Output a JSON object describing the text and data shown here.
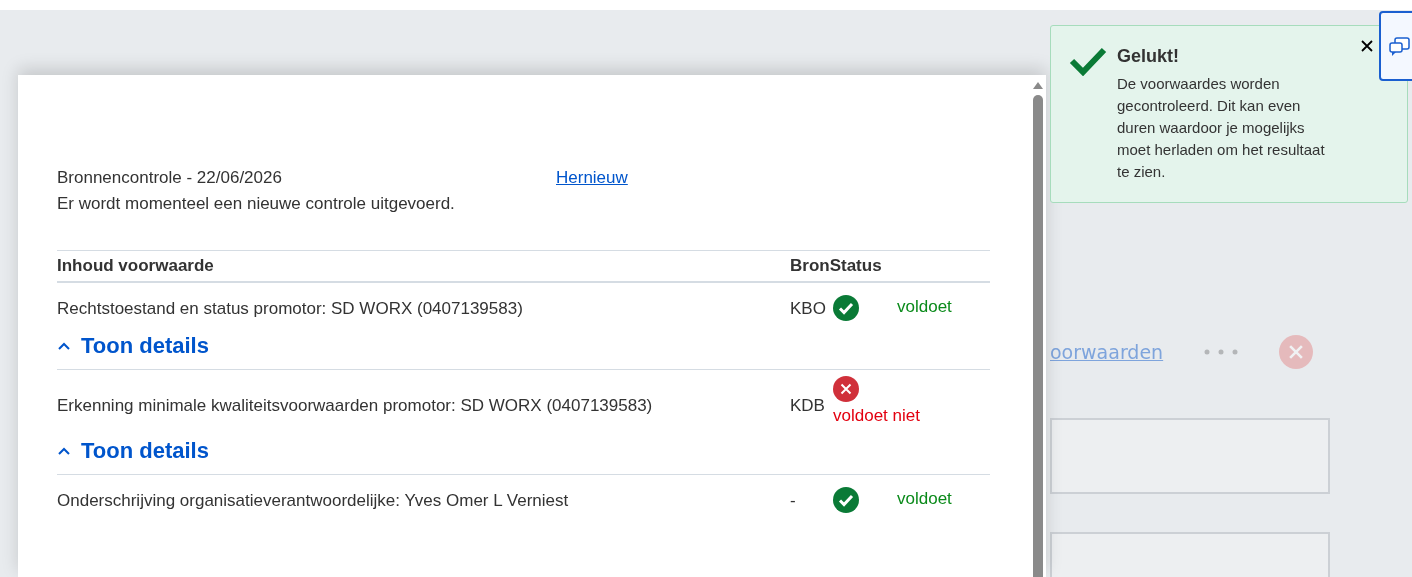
{
  "background": {
    "link": "oorwaarden"
  },
  "modal": {
    "check_title": "Bronnencontrole - 22/06/2026",
    "renew_link": "Hernieuw",
    "message": "Er wordt momenteel een nieuwe controle uitgevoerd.",
    "columns": [
      "Inhoud voorwaarde",
      "BronStatus"
    ],
    "rows": [
      {
        "content": "Rechtstoestand en status promotor: SD WORX (0407139583)",
        "source": "KBO",
        "kind": "ok",
        "status": "voldoet",
        "details": {
          "label": "Toon details",
          "expanded": true
        }
      },
      {
        "content": "Erkenning minimale kwaliteitsvoorwaarden promotor: SD WORX (0407139583)",
        "source": "KDB",
        "kind": "fail",
        "status": "voldoet niet",
        "details": {
          "label": "Toon details",
          "expanded": true
        }
      },
      {
        "content": "Onderschrijving organisatieverantwoordelijke: Yves Omer L Verniest",
        "source": "-",
        "kind": "ok",
        "status": "voldoet"
      }
    ]
  },
  "toast": {
    "title": "Gelukt!",
    "message": "De voorwaardes worden gecontroleerd. Dit kan even duren waardoor je mogelijks moet herladen om het resultaat te zien."
  }
}
